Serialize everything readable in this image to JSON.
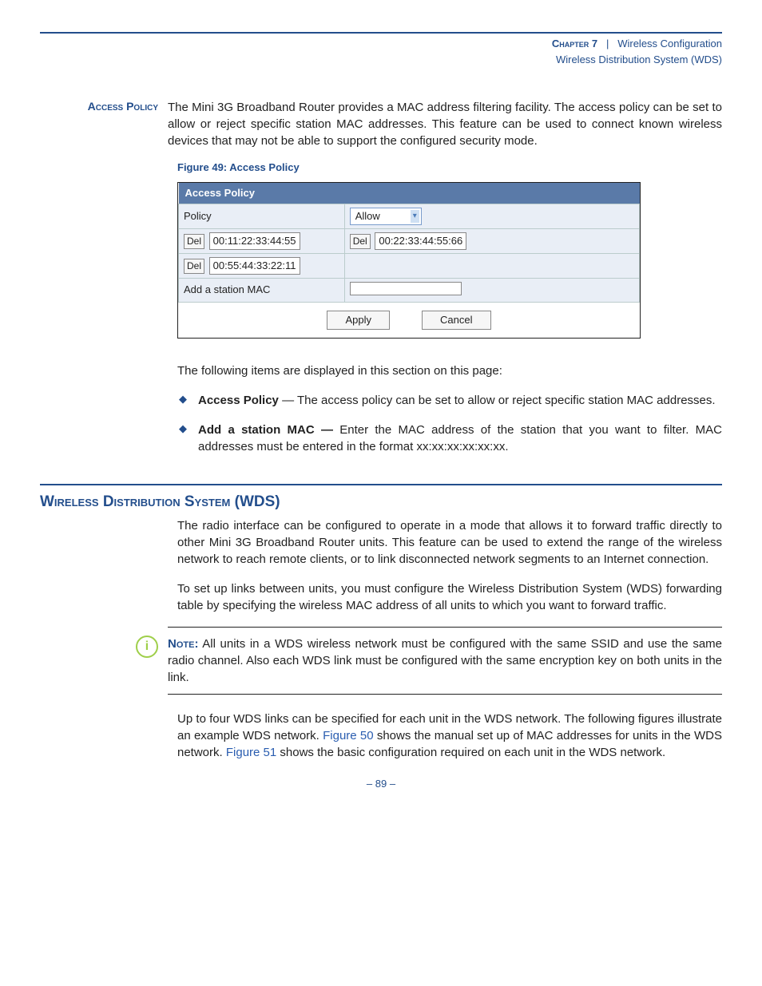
{
  "header": {
    "chapter_label": "Chapter 7",
    "separator": "|",
    "chapter_title": "Wireless Configuration",
    "section_title": "Wireless Distribution System (WDS)"
  },
  "access_policy": {
    "side_label": "Access Policy",
    "intro": "The Mini 3G Broadband Router provides a MAC address filtering facility. The access policy can be set to allow or reject specific station MAC addresses. This feature can be used to connect known wireless devices that may not be able to support the configured security mode.",
    "figure_caption": "Figure 49:  Access Policy",
    "panel_title": "Access Policy",
    "policy_label": "Policy",
    "policy_value": "Allow",
    "del_label": "Del",
    "mac1": "00:11:22:33:44:55",
    "mac2": "00:22:33:44:55:66",
    "mac3": "00:55:44:33:22:11",
    "add_label": "Add a station MAC",
    "apply_label": "Apply",
    "cancel_label": "Cancel",
    "items_intro": "The following items are displayed in this section on this page:",
    "bullets": [
      {
        "term": "Access Policy",
        "sep": " — ",
        "desc": "The access policy can be set to allow or reject specific station MAC addresses."
      },
      {
        "term": "Add a station MAC — ",
        "sep": "",
        "desc": "Enter the MAC address of the station that you want to filter. MAC addresses must be entered in the format xx:xx:xx:xx:xx:xx."
      }
    ]
  },
  "wds": {
    "heading": "Wireless Distribution System (WDS)",
    "p1": "The radio interface can be configured to operate in a mode that allows it to forward traffic directly to other Mini 3G Broadband Router units. This feature can be used to extend the range of the wireless network to reach remote clients, or to link disconnected network segments to an Internet connection.",
    "p2": "To set up links between units, you must configure the Wireless Distribution System (WDS) forwarding table by specifying the wireless MAC address of all units to which you want to forward traffic.",
    "note_label": "Note:",
    "note_body": " All units in a WDS wireless network must be configured with the same SSID and use the same radio channel. Also each WDS link must be configured with the same encryption key on both units in the link.",
    "p3a": "Up to four WDS links can be specified for each unit in the WDS network. The following figures illustrate an example WDS network. ",
    "link1": "Figure 50",
    "p3b": " shows the manual set up of MAC addresses for units in the WDS network. ",
    "link2": "Figure 51",
    "p3c": " shows the basic configuration required on each unit in the WDS network."
  },
  "page_number": "–  89  –"
}
